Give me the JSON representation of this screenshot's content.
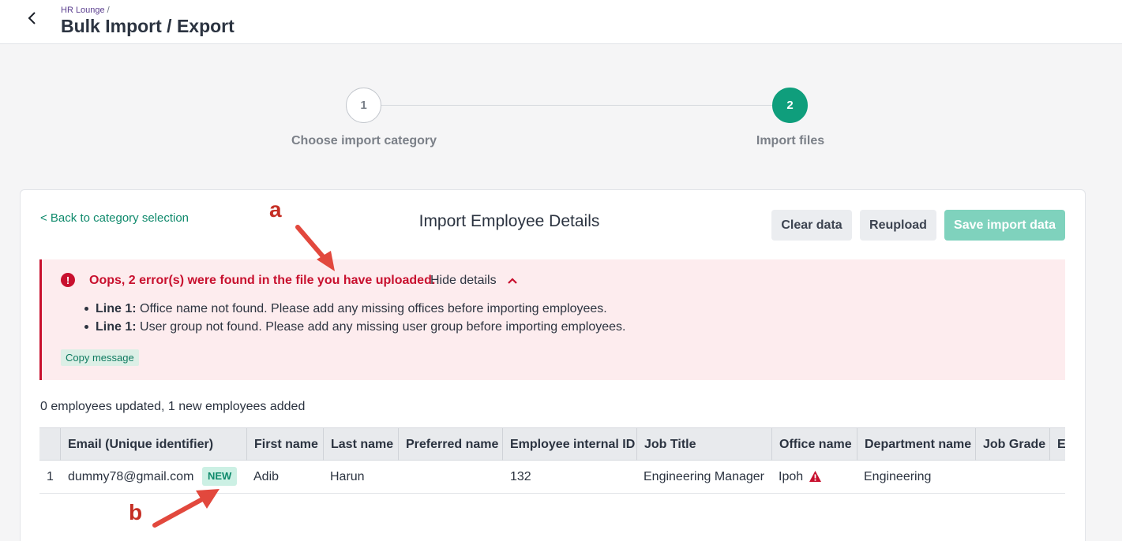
{
  "header": {
    "breadcrumb": "HR Lounge",
    "breadcrumb_sep": "/",
    "title": "Bulk Import / Export"
  },
  "stepper": {
    "steps": [
      {
        "number": "1",
        "label": "Choose import category"
      },
      {
        "number": "2",
        "label": "Import files"
      }
    ],
    "active_color": "#0f9e7c"
  },
  "card": {
    "back_link": "< Back to category selection",
    "title": "Import Employee Details",
    "buttons": {
      "clear": "Clear data",
      "reupload": "Reupload",
      "save": "Save import data"
    }
  },
  "error": {
    "icon_glyph": "!",
    "heading": "Oops, 2 error(s) were found in the file you have uploaded.",
    "toggle": "Hide details",
    "items": [
      {
        "line": "Line 1:",
        "message": " Office name not found. Please add any missing offices before importing employees."
      },
      {
        "line": "Line 1:",
        "message": " User group not found. Please add any missing user group before importing employees."
      }
    ],
    "copy_label": "Copy message",
    "color": "#c8102e"
  },
  "summary": "0 employees updated, 1 new employees added",
  "table": {
    "columns": [
      "",
      "Email (Unique identifier)",
      "First name",
      "Last name",
      "Preferred name",
      "Employee internal ID",
      "Job Title",
      "Office name",
      "Department name",
      "Job Grade",
      "Employment"
    ],
    "rows": [
      {
        "index": "1",
        "email": "dummy78@gmail.com",
        "badge": "NEW",
        "first_name": "Adib",
        "last_name": "Harun",
        "preferred_name": "",
        "internal_id": "132",
        "job_title": "Engineering Manager",
        "office": "Ipoh",
        "department": "Engineering",
        "job_grade": ""
      }
    ]
  },
  "annotations": {
    "a": "a",
    "b": "b",
    "color": "#c52e24"
  }
}
